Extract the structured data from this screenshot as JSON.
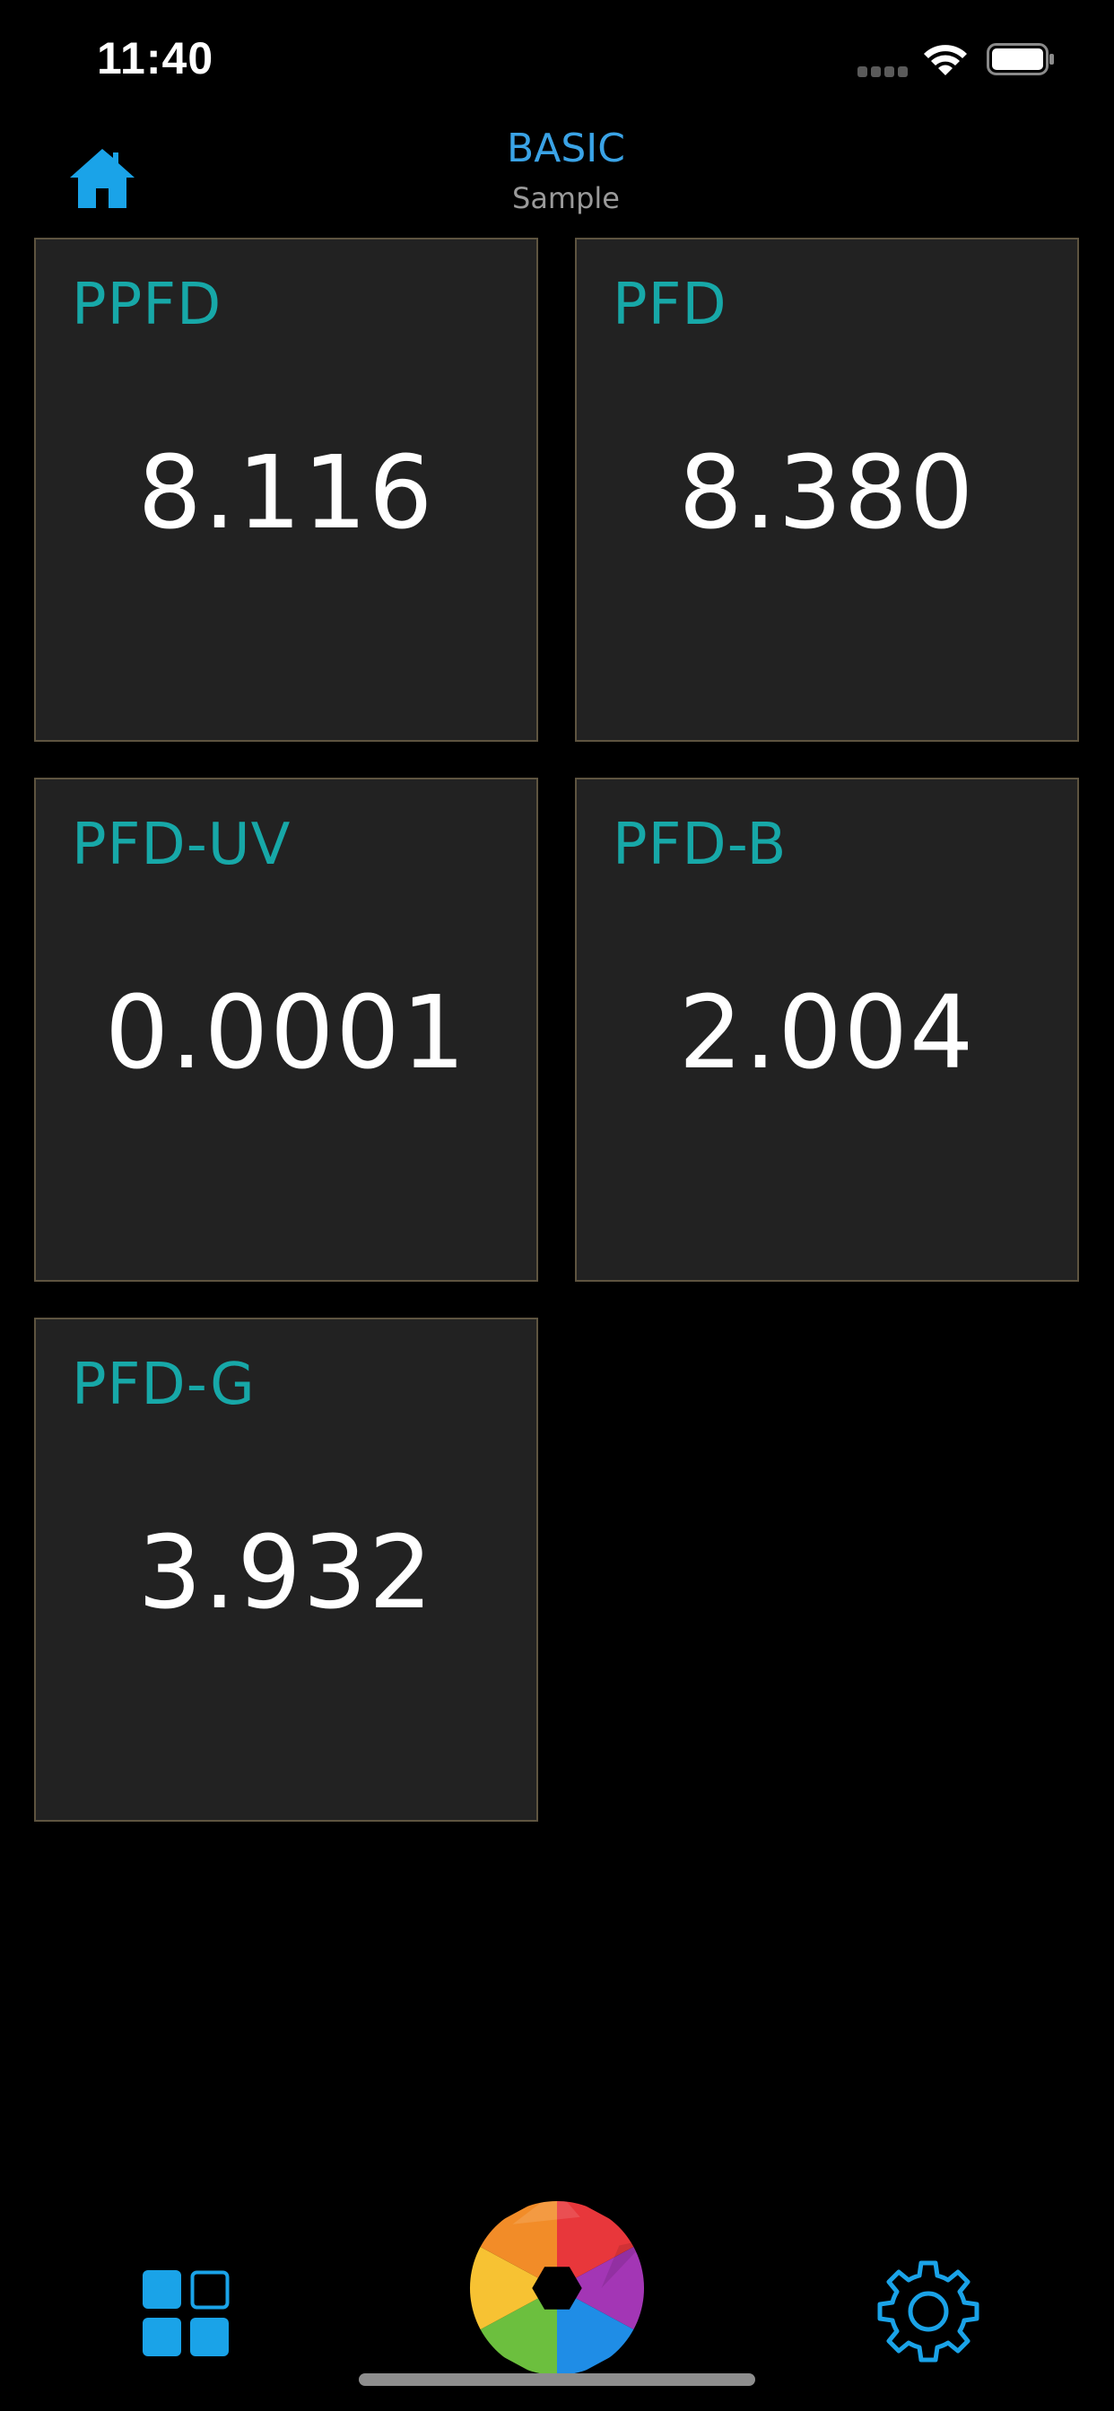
{
  "status_bar": {
    "time": "11:40"
  },
  "header": {
    "title": "BASIC",
    "subtitle": "Sample",
    "home_icon": "house-icon"
  },
  "tiles": [
    {
      "label": "PPFD",
      "value": "8.116"
    },
    {
      "label": "PFD",
      "value": "8.380"
    },
    {
      "label": "PFD-UV",
      "value": "0.0001"
    },
    {
      "label": "PFD-B",
      "value": "2.004"
    },
    {
      "label": "PFD-G",
      "value": "3.932"
    }
  ],
  "bottom_bar": {
    "left_icon": "grid-icon",
    "center_icon": "aperture-icon",
    "right_icon": "gear-icon"
  },
  "colors": {
    "accent_blue": "#3aa3e6",
    "icon_blue": "#1aa3e8",
    "label_teal": "#17a8a8",
    "tile_background": "#222222",
    "tile_border": "#5e5440",
    "page_background": "#000000"
  }
}
